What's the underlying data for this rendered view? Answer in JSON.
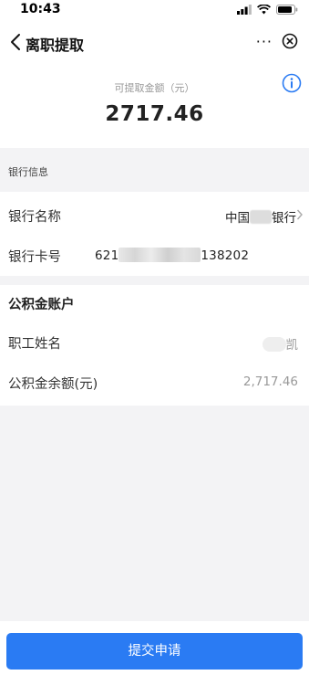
{
  "status_bar": {
    "time": "10:43"
  },
  "nav": {
    "title": "离职提取",
    "more": "···"
  },
  "amount": {
    "label": "可提取金额（元）",
    "value": "2717.46"
  },
  "bank_section": {
    "title": "银行信息",
    "bank_name_label": "银行名称",
    "bank_name_prefix": "中国",
    "bank_name_suffix": "银行",
    "card_label": "银行卡号",
    "card_prefix": "621",
    "card_suffix": "138202"
  },
  "gjj_section": {
    "title": "公积金账户",
    "name_label": "职工姓名",
    "name_value": "凯",
    "balance_label": "公积金余额(元)",
    "balance_value": "2,717.46"
  },
  "submit": {
    "label": "提交申请"
  },
  "colors": {
    "accent": "#2a7bf3",
    "background": "#f3f3f5"
  }
}
